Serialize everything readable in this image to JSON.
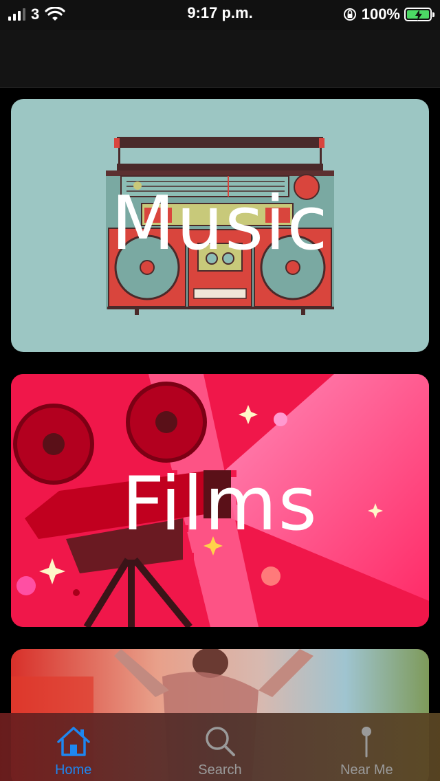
{
  "status_bar": {
    "carrier": "3",
    "time": "9:17 p.m.",
    "battery_percent": "100%",
    "signal_bars": 3,
    "signal_bars_total": 4
  },
  "cards": [
    {
      "title": "Music",
      "color": "#9cc6c3"
    },
    {
      "title": "Films",
      "color": "#f0174a"
    },
    {
      "title": "",
      "color": "#c9593e"
    }
  ],
  "tab_bar": {
    "tabs": [
      {
        "label": "Home",
        "icon": "home-icon",
        "active": true
      },
      {
        "label": "Search",
        "icon": "search-icon",
        "active": false
      },
      {
        "label": "Near Me",
        "icon": "pin-icon",
        "active": false
      }
    ],
    "active_color": "#1e87f0",
    "inactive_color": "#9a9a9a"
  }
}
